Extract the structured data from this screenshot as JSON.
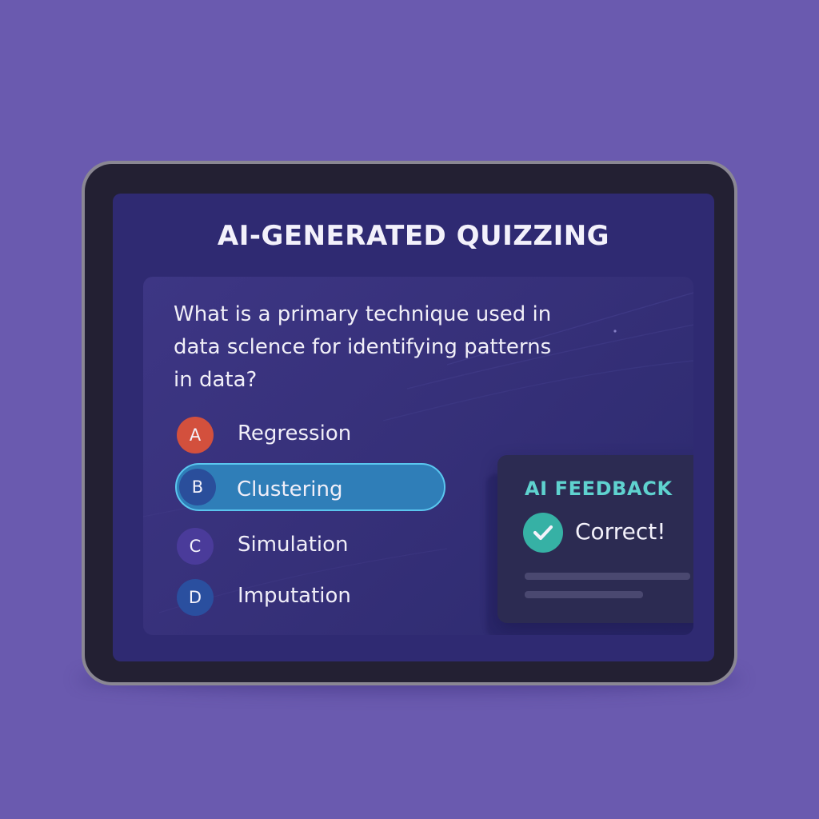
{
  "title": "AI-GENERATED QUIZZING",
  "question": "What is a primary technique used in data sclence for identifying patterns in data?",
  "options": [
    {
      "letter": "A",
      "label": "Regression",
      "color": "#d3503d",
      "selected": false
    },
    {
      "letter": "B",
      "label": "Clustering",
      "color": "#2a4e9b",
      "selected": true
    },
    {
      "letter": "C",
      "label": "Simulation",
      "color": "#4a3b9a",
      "selected": false
    },
    {
      "letter": "D",
      "label": "Imputation",
      "color": "#2a4f9f",
      "selected": false
    }
  ],
  "feedback": {
    "title": "AI FEEDBACK",
    "status": "Correct!",
    "icon": "check-icon",
    "status_color": "#36b1a5"
  },
  "colors": {
    "background": "#6a5aaf",
    "screen": "#2f2a72",
    "accent": "#5fd2cf",
    "selected_option": "#2f7eb8"
  }
}
